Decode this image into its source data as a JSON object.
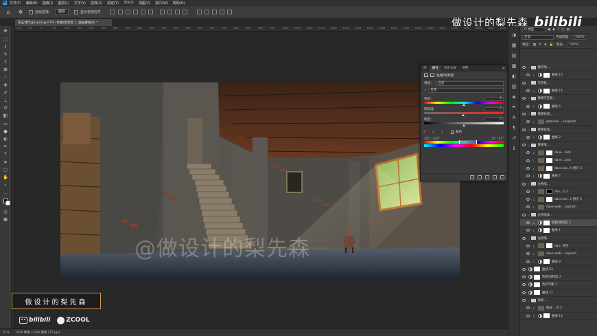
{
  "menubar": {
    "app_icon": "Ps",
    "items": [
      "文件(F)",
      "编辑(E)",
      "图像(I)",
      "图层(L)",
      "文字(Y)",
      "选择(S)",
      "滤镜(T)",
      "3D(D)",
      "视图(V)",
      "窗口(W)",
      "帮助(H)"
    ]
  },
  "options": {
    "auto_select_label": "自动选择：",
    "auto_select_value": "图层",
    "transform_label": "显示变换控件"
  },
  "document": {
    "tab_title": "第五课作业2.psd @ 67% (色相/饱和度 1, 图层蒙版/8) *"
  },
  "ruler_ticks": [
    "100",
    "50",
    "0",
    "50",
    "100",
    "150",
    "200",
    "250",
    "300",
    "350",
    "400",
    "450",
    "500",
    "550",
    "600",
    "650",
    "700",
    "750",
    "800",
    "850",
    "900",
    "950",
    "1000",
    "1050",
    "1100",
    "1150",
    "1200",
    "1250",
    "1300",
    "1350",
    "1400",
    "1450",
    "1500",
    "1550",
    "1600",
    "1650",
    "1700",
    "1750",
    "1800",
    "1850",
    "1900"
  ],
  "watermark": "@做设计的梨先森",
  "statusbar": {
    "zoom": "67%",
    "doc_info": "1920 像素 x 930 像素 (72 ppi)"
  },
  "brand": {
    "box_text": "做设计的梨先森",
    "bili_text": "bilibili",
    "zcool_text": "ZCOOL",
    "top_cn": "做设计的梨先森",
    "top_bili": "bilibili"
  },
  "properties": {
    "tabs": [
      "库",
      "属性",
      "历史记录",
      "调整"
    ],
    "header": "色相/饱和度",
    "preset_label": "预设：",
    "preset_value": "自定",
    "channel_value": "红色",
    "hue_label": "色相：",
    "hue_value": "0",
    "sat_label": "饱和度：",
    "sat_value": "-2",
    "light_label": "明度：",
    "light_value": "0",
    "colorize_label": "着色",
    "range_left": "315° / 345°",
    "range_right": "15° \\ 45°",
    "hue_fraction": 0.5,
    "sat_fraction": 0.49,
    "light_fraction": 0.5
  },
  "layers_panel": {
    "filter_label": "Q 类型",
    "blend_mode": "正常",
    "opacity_label": "不透明度：",
    "opacity_value": "100%",
    "lock_label": "锁定：",
    "fill_label": "填充：",
    "fill_value": "100%",
    "layers": [
      {
        "name": "蒙印墙...",
        "kind": "group",
        "indent": 0,
        "mask": "none"
      },
      {
        "name": "曲线 15",
        "kind": "adj",
        "indent": 1,
        "mask": "white"
      },
      {
        "name": "天花板...",
        "kind": "group",
        "indent": 0,
        "mask": "none"
      },
      {
        "name": "曲线 14",
        "kind": "adj",
        "indent": 1,
        "mask": "white"
      },
      {
        "name": "楼梯天花板...",
        "kind": "group",
        "indent": 0,
        "mask": "none"
      },
      {
        "name": "曲线 6",
        "kind": "adj",
        "indent": 1,
        "mask": "white"
      },
      {
        "name": "楼梯扶墙...",
        "kind": "group",
        "indent": 0,
        "mask": "none"
      },
      {
        "name": "gabriele-...unsplash",
        "kind": "pixel",
        "indent": 1,
        "mask": "none"
      },
      {
        "name": "楼梯扶墙...",
        "kind": "group",
        "indent": 0,
        "mask": "none"
      },
      {
        "name": "曲线 2",
        "kind": "adj",
        "indent": 1,
        "mask": "white"
      },
      {
        "name": "楼梯墙...",
        "kind": "group",
        "indent": 0,
        "mask": "none"
      },
      {
        "name": "dave...lash",
        "kind": "pixel",
        "indent": 1,
        "mask": "white"
      },
      {
        "name": "dave...lash",
        "kind": "pixel",
        "indent": 1,
        "mask": "white"
      },
      {
        "name": "dave-we...h 拷贝 4",
        "kind": "pixel",
        "indent": 1,
        "mask": "white"
      },
      {
        "name": "曲线 7",
        "kind": "adj",
        "indent": 1,
        "mask": "white"
      },
      {
        "name": "左侧墙...",
        "kind": "group",
        "indent": 0,
        "mask": "none"
      },
      {
        "name": "dav...贝 3",
        "kind": "pixel",
        "indent": 1,
        "mask": "black"
      },
      {
        "name": "dave-we...h 拷贝 2",
        "kind": "pixel",
        "indent": 1,
        "mask": "white"
      },
      {
        "name": "dave-web-...nsplash",
        "kind": "pixel",
        "indent": 1,
        "mask": "none"
      },
      {
        "name": "左侧墙体...",
        "kind": "group",
        "indent": 0,
        "mask": "none"
      },
      {
        "name": "色相/饱和度 3",
        "kind": "adj",
        "indent": 1,
        "mask": "white",
        "selected": true
      },
      {
        "name": "曲线 1",
        "kind": "adj",
        "indent": 1,
        "mask": "white"
      },
      {
        "name": "左侧墙...",
        "kind": "group",
        "indent": 0,
        "mask": "none"
      },
      {
        "name": "dav...拷贝",
        "kind": "pixel",
        "indent": 1,
        "mask": "white"
      },
      {
        "name": "dave-web-...nsplash",
        "kind": "pixel",
        "indent": 1,
        "mask": "none"
      },
      {
        "name": "曲线 9",
        "kind": "adj",
        "indent": 1,
        "mask": "white"
      },
      {
        "name": "曲线 23",
        "kind": "adj",
        "indent": 0,
        "mask": "white"
      },
      {
        "name": "色相/饱和度 2",
        "kind": "adj",
        "indent": 0,
        "mask": "white"
      },
      {
        "name": "色彩平衡 1",
        "kind": "adj",
        "indent": 0,
        "mask": "white"
      },
      {
        "name": "曲线 12",
        "kind": "adj",
        "indent": 0,
        "mask": "white"
      },
      {
        "name": "地板...",
        "kind": "group",
        "indent": 0,
        "mask": "none"
      },
      {
        "name": "图层 ...贝 2",
        "kind": "pixel",
        "indent": 1,
        "mask": "none"
      },
      {
        "name": "曲线 13",
        "kind": "adj",
        "indent": 1,
        "mask": "white"
      }
    ]
  },
  "colors": {
    "accent_brand_box": "#d59a4c",
    "ps_blue": "#31a8ff",
    "panel_bg": "#383838"
  }
}
